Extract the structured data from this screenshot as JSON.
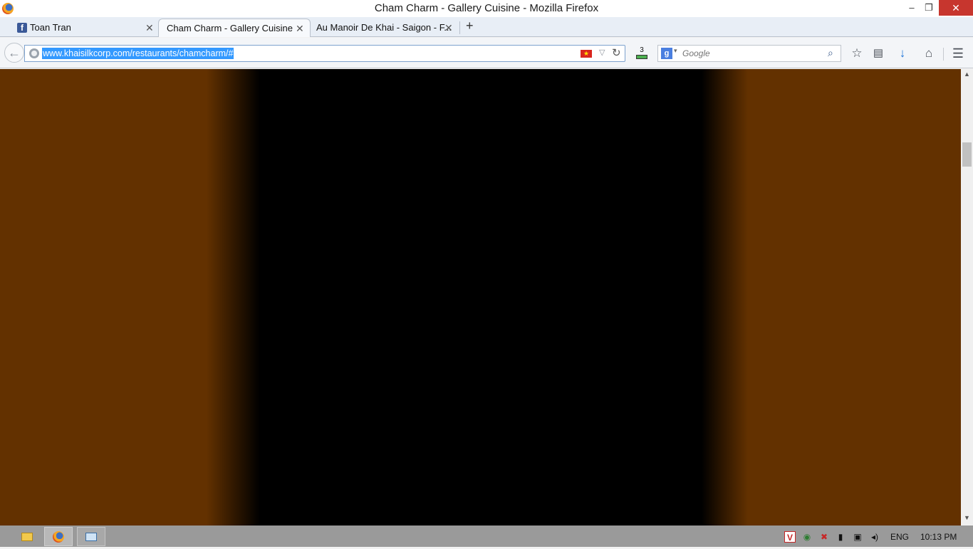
{
  "window": {
    "title": "Cham Charm - Gallery Cuisine - Mozilla Firefox",
    "minimize_glyph": "‒",
    "restore_glyph": "❐",
    "close_glyph": "✕"
  },
  "tabs": [
    {
      "label": "Toan Tran",
      "close": "✕",
      "icon": "facebook-icon",
      "icon_glyph": "f"
    },
    {
      "label": "Cham Charm - Gallery Cuisine",
      "close": "✕",
      "active": true
    },
    {
      "label": "Au Manoir De Khai - Saigon - F...",
      "close": "✕"
    }
  ],
  "new_tab_glyph": "+",
  "navbar": {
    "back_glyph": "←",
    "url": "www.khaisilkcorp.com/restaurants/chamcharm/#",
    "flag_glyph": "★",
    "dropdown_glyph": "▽",
    "reload_glyph": "↻",
    "extension_count": "3",
    "search_engine_glyph": "g",
    "search_arrow_glyph": "▾",
    "search_placeholder": "Google",
    "search_glyph": "⌕",
    "bookmark_glyph": "☆",
    "bookmarks_list_glyph": "▤",
    "download_glyph": "↓",
    "home_glyph": "⌂",
    "menu_glyph": "☰"
  },
  "scrollbar": {
    "up_glyph": "▲",
    "down_glyph": "▼"
  },
  "colors": {
    "page_side": "#633100",
    "page_center": "#000000",
    "url_highlight": "#3399ff",
    "close_button": "#c7362e"
  },
  "taskbar": {
    "tray": {
      "vivaldi_glyph": "V",
      "globe_glyph": "◉",
      "network_glyph": "✖",
      "battery_glyph": "▮",
      "display_glyph": "▣",
      "volume_glyph": "◂)",
      "language": "ENG",
      "clock": "10:13 PM"
    }
  }
}
